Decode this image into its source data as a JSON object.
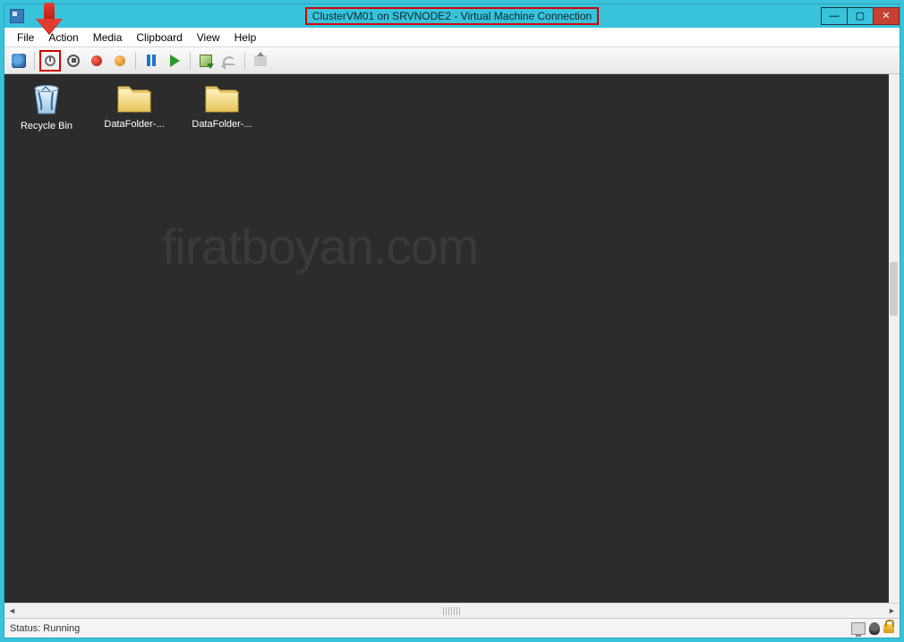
{
  "title": "ClusterVM01 on SRVNODE2 - Virtual Machine Connection",
  "window_controls": {
    "min": "—",
    "max": "▢",
    "close": "✕"
  },
  "menu": {
    "file": "File",
    "action": "Action",
    "media": "Media",
    "clipboard": "Clipboard",
    "view": "View",
    "help": "Help"
  },
  "toolbar": {
    "cad": "ctrl-alt-del-button",
    "start": "start-button",
    "turnoff": "turn-off-button",
    "shutdown": "shutdown-button",
    "save": "save-button",
    "pause": "pause-button",
    "reset": "reset-button",
    "checkpoint": "checkpoint-button",
    "revert": "revert-button",
    "share": "enhanced-session-button"
  },
  "desktop": {
    "items": [
      {
        "label": "Recycle Bin",
        "type": "recycle"
      },
      {
        "label": "DataFolder-...",
        "type": "folder"
      },
      {
        "label": "DataFolder-...",
        "type": "folder"
      }
    ],
    "watermark": "firatboyan.com"
  },
  "status": {
    "text": "Status: Running"
  }
}
